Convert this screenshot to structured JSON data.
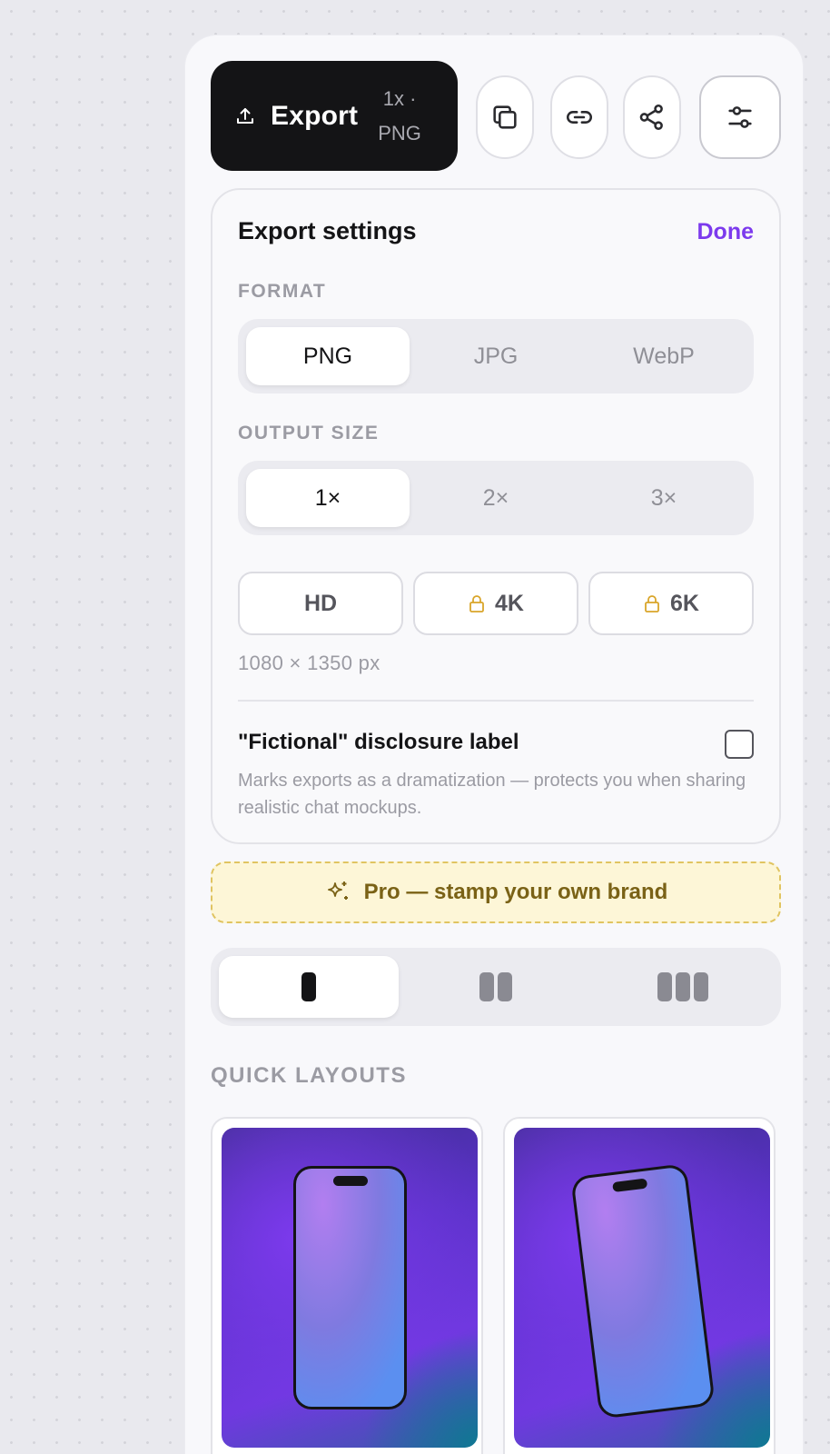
{
  "toolbar": {
    "export_label": "Export",
    "export_scale": "1x ·",
    "export_format": "PNG",
    "icons": [
      "upload-icon",
      "copy-icon",
      "link-icon",
      "share-icon",
      "sliders-icon"
    ]
  },
  "settings": {
    "title": "Export settings",
    "done_label": "Done",
    "format": {
      "label": "FORMAT",
      "options": [
        "PNG",
        "JPG",
        "WebP"
      ],
      "selected": "PNG"
    },
    "output_size": {
      "label": "OUTPUT SIZE",
      "options": [
        "1×",
        "2×",
        "3×"
      ],
      "selected": "1×"
    },
    "resolutions": [
      {
        "label": "HD",
        "locked": false
      },
      {
        "label": "4K",
        "locked": true
      },
      {
        "label": "6K",
        "locked": true
      }
    ],
    "dimensions": "1080 × 1350 px",
    "disclosure": {
      "title": "\"Fictional\" disclosure label",
      "description": "Marks exports as a dramatization — protects you when sharing realistic chat mockups.",
      "checked": false
    }
  },
  "pro_banner": {
    "label": "Pro — stamp your own brand"
  },
  "columns": {
    "options": [
      1,
      2,
      3
    ],
    "selected": 1
  },
  "quick_layouts": {
    "label": "QUICK LAYOUTS",
    "items": [
      {
        "name": "straight-phone"
      },
      {
        "name": "tilted-phone"
      }
    ]
  },
  "colors": {
    "accent": "#7c3aed",
    "pro_text": "#7a6216",
    "pro_bg": "#fdf6d7",
    "export_bg": "#141416"
  }
}
